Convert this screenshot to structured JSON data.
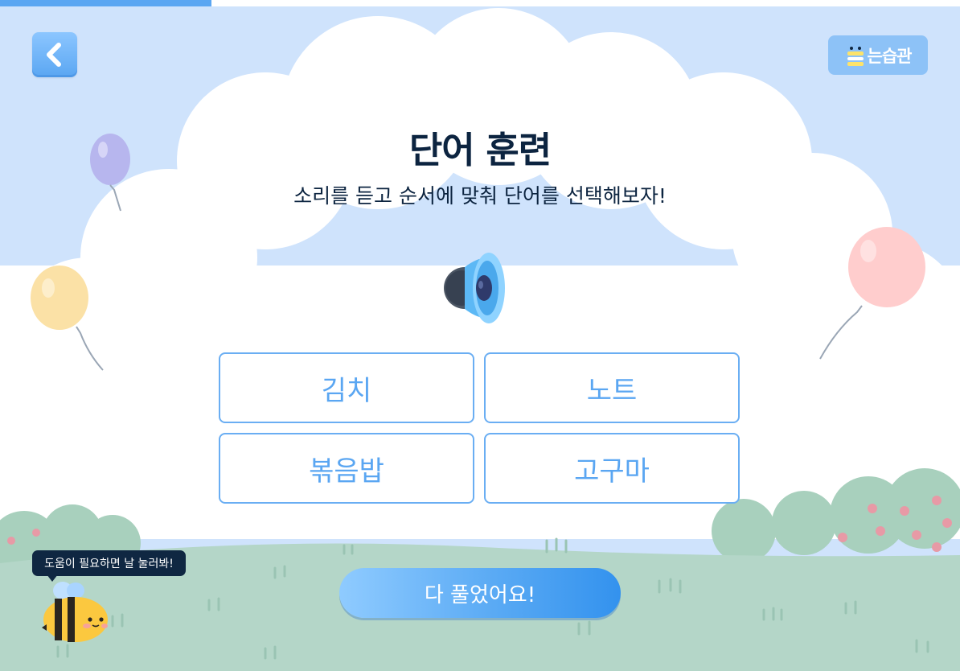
{
  "progress": {
    "value": 0.22
  },
  "header": {
    "back_icon": "chevron-left-icon",
    "logo_text": "는습관",
    "logo_icon": "bee-icon"
  },
  "main": {
    "title": "단어 훈련",
    "subtitle": "소리를 듣고 순서에 맞춰 단어를 선택해보자!",
    "speaker_icon": "speaker-icon",
    "options": [
      {
        "label": "김치"
      },
      {
        "label": "노트"
      },
      {
        "label": "볶음밥"
      },
      {
        "label": "고구마"
      }
    ],
    "done_label": "다 풀었어요!"
  },
  "helper": {
    "bubble_text": "도움이 필요하면 날 눌러봐!",
    "mascot_icon": "bee-mascot-icon"
  },
  "colors": {
    "accent": "#5aa6f2",
    "title": "#0c2440",
    "sky": "#cfe3fc",
    "grass": "#b4d6c8",
    "bubble": "#0f2742"
  }
}
